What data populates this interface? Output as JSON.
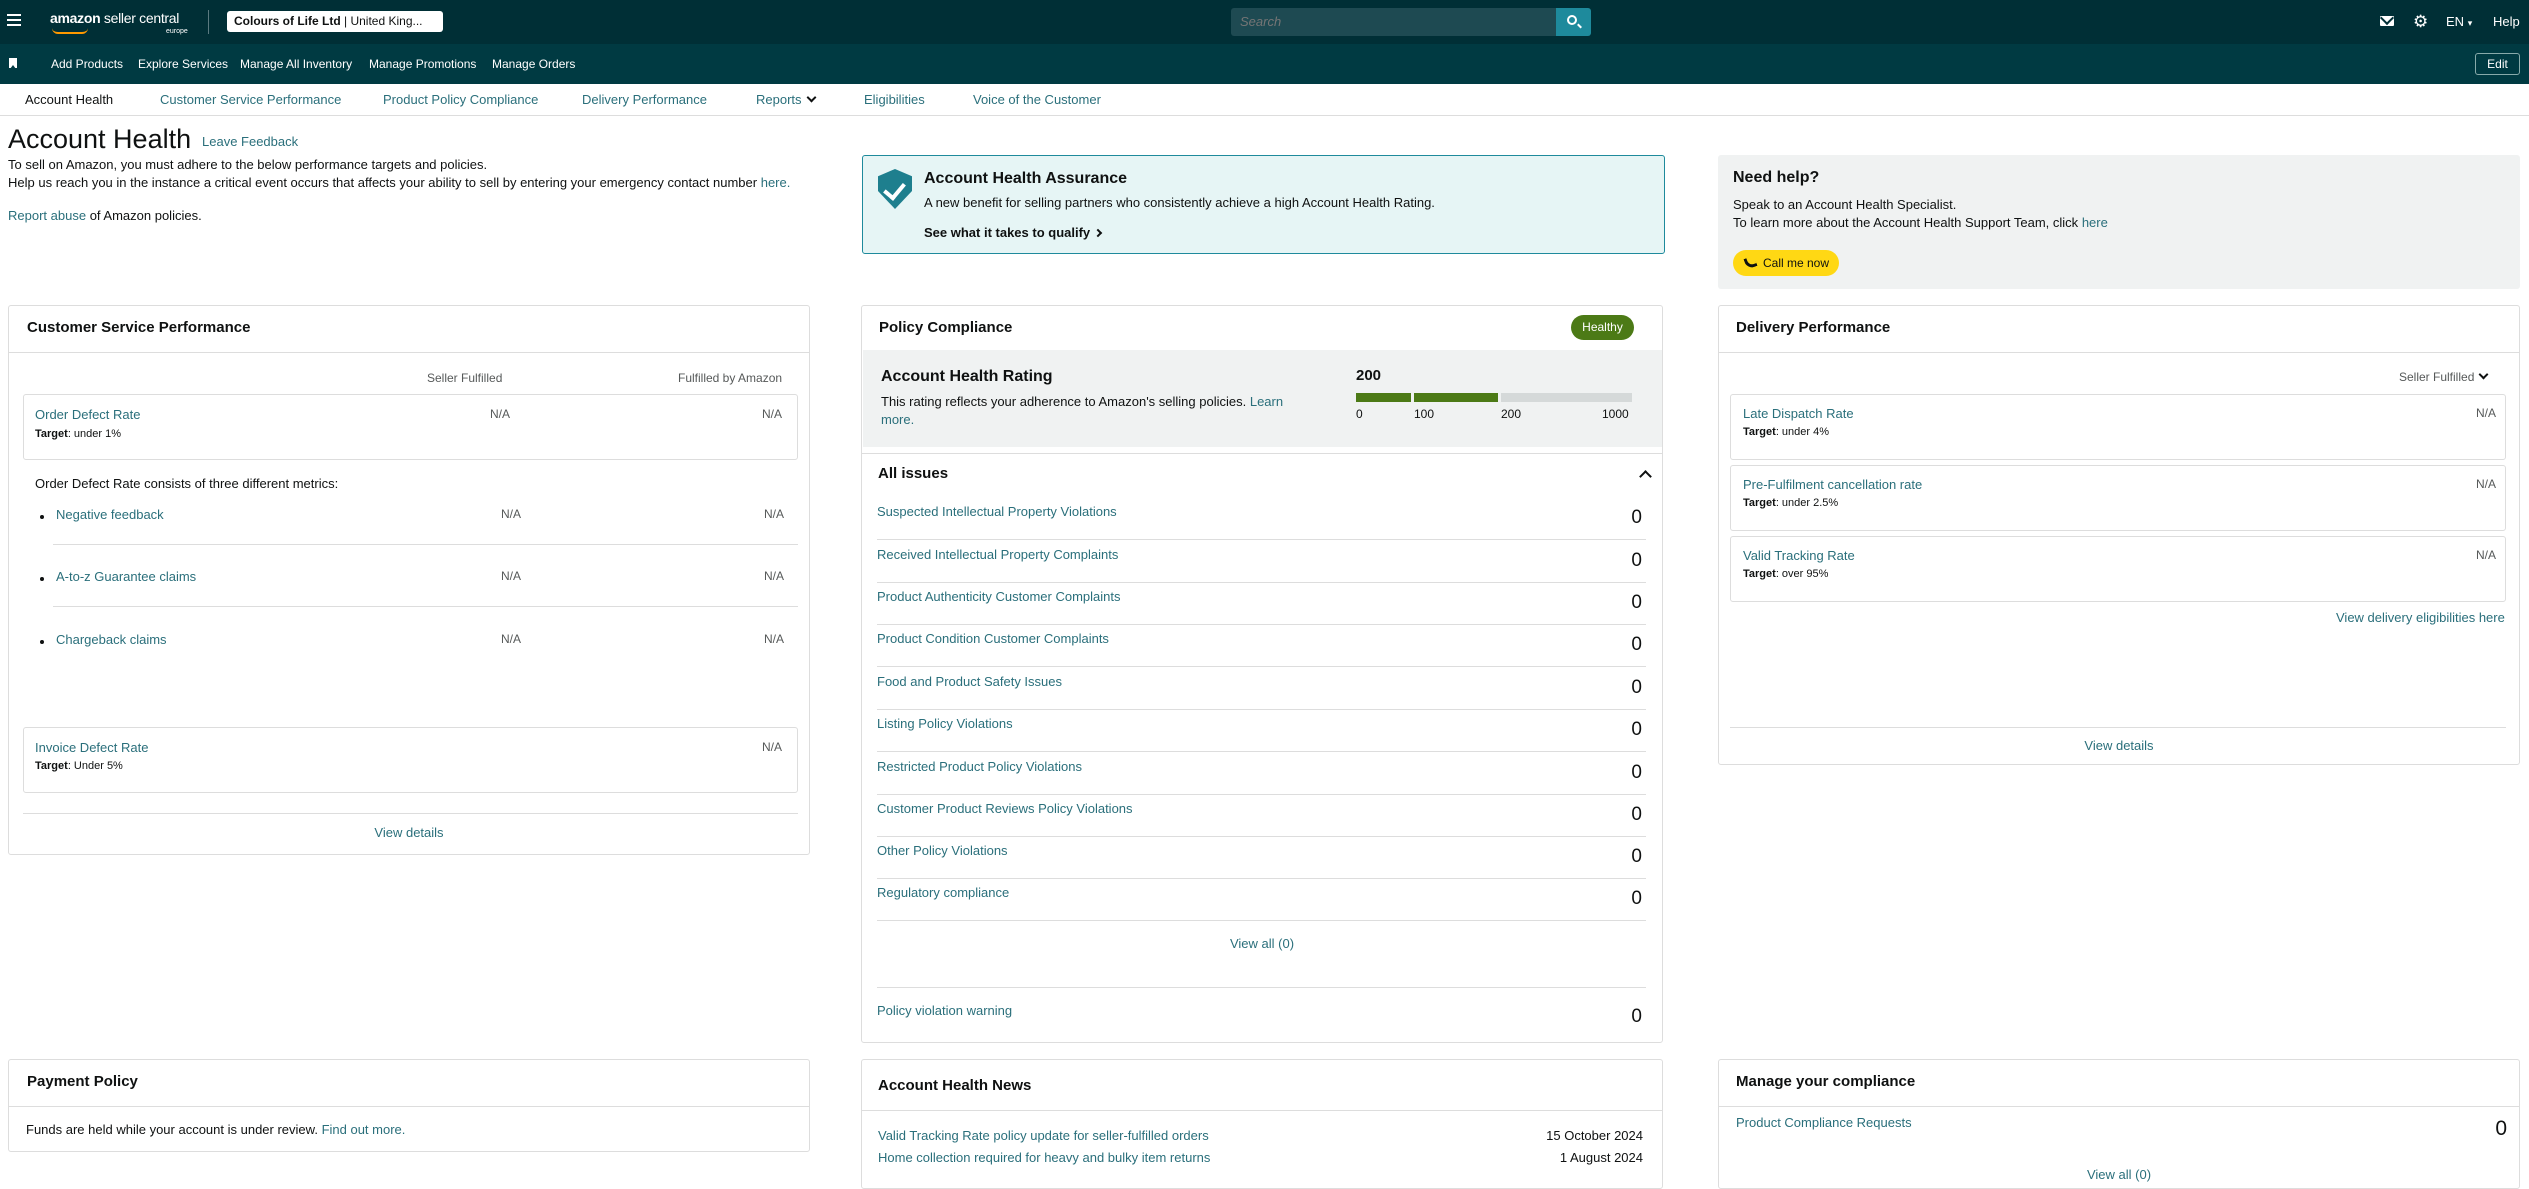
{
  "topbar": {
    "logo_text_1": "amazon",
    "logo_text_2": "seller central",
    "logo_region": "europe",
    "account_name": "Colours of Life Ltd",
    "account_region": "United King...",
    "search_placeholder": "Search",
    "lang": "EN",
    "help": "Help"
  },
  "bookmarks": {
    "items": [
      "Add Products",
      "Explore Services",
      "Manage All Inventory",
      "Manage Promotions",
      "Manage Orders"
    ],
    "edit": "Edit"
  },
  "subnav": [
    "Account Health",
    "Customer Service Performance",
    "Product Policy Compliance",
    "Delivery Performance",
    "Reports",
    "Eligibilities",
    "Voice of the Customer"
  ],
  "header": {
    "title": "Account Health",
    "leave_feedback": "Leave Feedback",
    "intro_1": "To sell on Amazon, you must adhere to the below performance targets and policies.",
    "intro_2": "Help us reach you in the instance a critical event occurs that affects your ability to sell by entering your emergency contact number",
    "intro_2_link": "here.",
    "report_abuse": "Report abuse",
    "report_abuse_rest": "of Amazon policies."
  },
  "aha": {
    "title": "Account Health Assurance",
    "desc": "A new benefit for selling partners who consistently achieve a high Account Health Rating.",
    "qualify": "See what it takes to qualify"
  },
  "need_help": {
    "title": "Need help?",
    "line1": "Speak to an Account Health Specialist.",
    "line2": "To learn more about the Account Health Support Team, click",
    "line2_link": "here",
    "call": "Call me now"
  },
  "csp": {
    "title": "Customer Service Performance",
    "col1": "Seller Fulfilled",
    "col2": "Fulfilled by Amazon",
    "odr": {
      "name": "Order Defect Rate",
      "target_label": "Target",
      "target": ": under 1%",
      "v1": "N/A",
      "v2": "N/A"
    },
    "consists": "Order Defect Rate consists of three different metrics:",
    "metrics": [
      {
        "name": "Negative feedback",
        "v1": "N/A",
        "v2": "N/A"
      },
      {
        "name": "A-to-z Guarantee claims",
        "v1": "N/A",
        "v2": "N/A"
      },
      {
        "name": "Chargeback claims",
        "v1": "N/A",
        "v2": "N/A"
      }
    ],
    "idr": {
      "name": "Invoice Defect Rate",
      "target_label": "Target",
      "target": ": Under 5%",
      "v": "N/A"
    },
    "view_details": "View details"
  },
  "policy": {
    "title": "Policy Compliance",
    "badge": "Healthy",
    "ahr_title": "Account Health Rating",
    "ahr_desc": "This rating reflects your adherence to Amazon's selling policies.",
    "ahr_learn": "Learn more.",
    "ahr_value": "200",
    "ahr_scale": [
      "0",
      "100",
      "200",
      "1000"
    ],
    "all_issues": "All issues",
    "issues": [
      {
        "name": "Suspected Intellectual Property Violations",
        "value": "0"
      },
      {
        "name": "Received Intellectual Property Complaints",
        "value": "0"
      },
      {
        "name": "Product Authenticity Customer Complaints",
        "value": "0"
      },
      {
        "name": "Product Condition Customer Complaints",
        "value": "0"
      },
      {
        "name": "Food and Product Safety Issues",
        "value": "0"
      },
      {
        "name": "Listing Policy Violations",
        "value": "0"
      },
      {
        "name": "Restricted Product Policy Violations",
        "value": "0"
      },
      {
        "name": "Customer Product Reviews Policy Violations",
        "value": "0"
      },
      {
        "name": "Other Policy Violations",
        "value": "0"
      },
      {
        "name": "Regulatory compliance",
        "value": "0"
      }
    ],
    "view_all": "View all (0)",
    "warning": {
      "name": "Policy violation warning",
      "value": "0"
    }
  },
  "delivery": {
    "title": "Delivery Performance",
    "dropdown": "Seller Fulfilled",
    "metrics": [
      {
        "name": "Late Dispatch Rate",
        "target_label": "Target",
        "target": ": under 4%",
        "v": "N/A"
      },
      {
        "name": "Pre-Fulfilment cancellation rate",
        "target_label": "Target",
        "target": ": under 2.5%",
        "v": "N/A"
      },
      {
        "name": "Valid Tracking Rate",
        "target_label": "Target",
        "target": ": over 95%",
        "v": "N/A"
      }
    ],
    "eligibilities": "View delivery eligibilities here",
    "view_details": "View details"
  },
  "payment": {
    "title": "Payment Policy",
    "desc": "Funds are held while your account is under review.",
    "link": "Find out more."
  },
  "news": {
    "title": "Account Health News",
    "items": [
      {
        "title": "Valid Tracking Rate policy update for seller-fulfilled orders",
        "date": "15 October 2024"
      },
      {
        "title": "Home collection required for heavy and bulky item returns",
        "date": "1 August 2024"
      }
    ]
  },
  "compliance": {
    "title": "Manage your compliance",
    "item": {
      "name": "Product Compliance Requests",
      "value": "0"
    },
    "view_all": "View all (0)"
  },
  "colors": {
    "topbar": "#002f36",
    "link": "#2a6f7b",
    "badge": "#4c7a16",
    "call": "#ffd814"
  }
}
